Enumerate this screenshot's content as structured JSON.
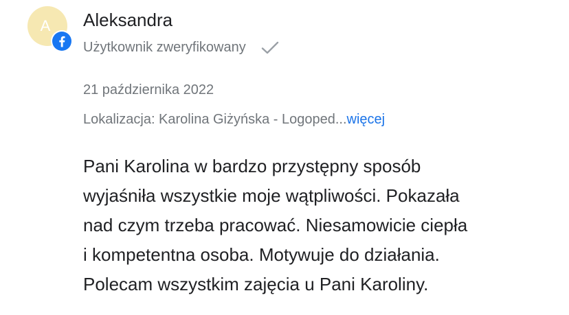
{
  "reviewer": {
    "initial": "A",
    "name": "Aleksandra",
    "status": "Użytkownik zweryfikowany",
    "avatar_color": "#f6e8b2",
    "badge_icon": "facebook-icon",
    "badge_color": "#1877f2",
    "verified_icon": "checkmark-icon"
  },
  "review": {
    "date": "21 października 2022",
    "location_prefix": "Lokalizacja: Karolina Giżyńska - Logoped...",
    "more_link": "więcej",
    "text_lines": [
      "Pani Karolina w bardzo przystępny sposób",
      "wyjaśniła wszystkie moje wątpliwości. Pokazała",
      "nad czym trzeba pracować. Niesamowicie ciepła",
      "i kompetentna osoba. Motywuje do działania.",
      "Polecam wszystkim zajęcia u Pani Karoliny."
    ]
  },
  "colors": {
    "link": "#1a73e8",
    "secondary_text": "#70757a",
    "primary_text": "#202124"
  }
}
